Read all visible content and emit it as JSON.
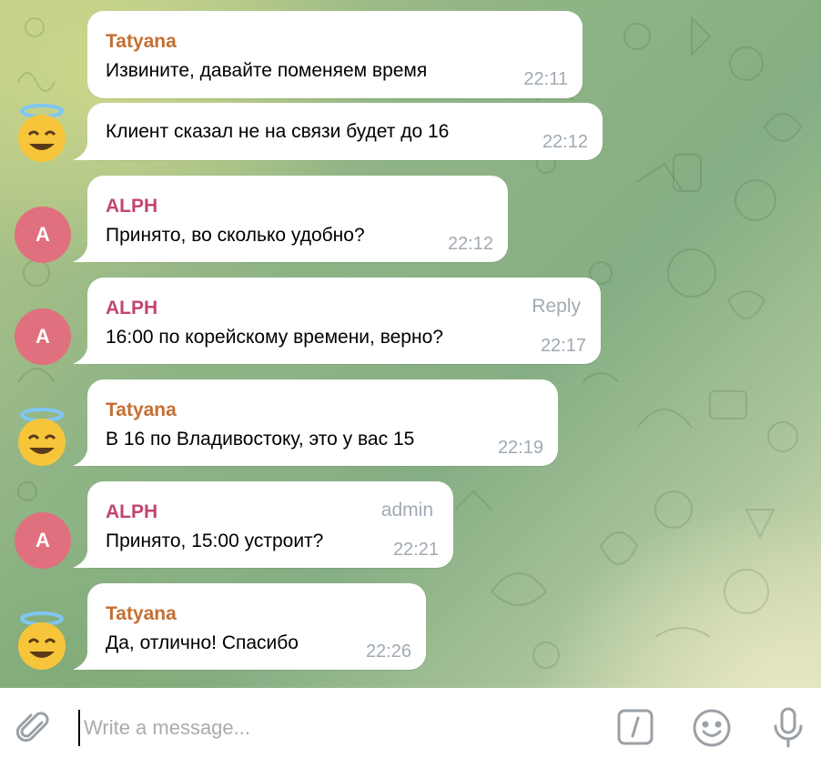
{
  "chat": {
    "messages": [
      {
        "sender": "Tatyana",
        "text": "Извините, давайте поменяем время",
        "time": "22:11"
      },
      {
        "sender": "",
        "text": "Клиент сказал не на связи будет до 16",
        "time": "22:12"
      },
      {
        "sender": "ALPH",
        "text": "Принято, во сколько удобно?",
        "time": "22:12",
        "avatar_letter": "A"
      },
      {
        "sender": "ALPH",
        "badge": "Reply",
        "text": "16:00 по корейскому времени, верно?",
        "time": "22:17",
        "avatar_letter": "A"
      },
      {
        "sender": "Tatyana",
        "text": "В 16 по Владивостоку, это у вас 15",
        "time": "22:19"
      },
      {
        "sender": "ALPH",
        "badge": "admin",
        "text": "Принято, 15:00 устроит?",
        "time": "22:21",
        "avatar_letter": "A"
      },
      {
        "sender": "Tatyana",
        "text": "Да, отлично! Спасибо",
        "time": "22:26"
      }
    ]
  },
  "composer": {
    "placeholder": "Write a message...",
    "icons": [
      "paperclip-icon",
      "slash-commands-icon",
      "emoji-icon",
      "microphone-icon"
    ]
  },
  "colors": {
    "tatyana_name": "#c46f33",
    "alph_name": "#c0466f",
    "alph_avatar": "#e0707e",
    "time": "#a0aab3"
  }
}
